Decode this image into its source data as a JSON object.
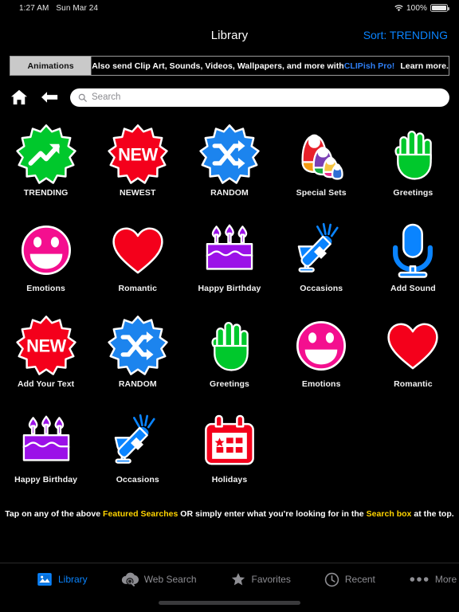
{
  "status_bar": {
    "time": "1:27 AM",
    "date": "Sun Mar 24",
    "battery_percent": "100%",
    "wifi_icon": "wifi-icon",
    "battery_icon": "battery-icon"
  },
  "navbar": {
    "title": "Library",
    "sort_label": "Sort: TRENDING",
    "accent_color": "#0a84ff"
  },
  "banner": {
    "tab_label": "Animations",
    "message_prefix": "Also send Clip Art, Sounds, Videos, Wallpapers, and more with ",
    "message_brand": "CLIPish Pro!",
    "learn_more": "Learn more.",
    "brand_color": "#2f7ff5"
  },
  "toolbar": {
    "home_icon": "home-icon",
    "back_icon": "back-arrow-icon",
    "search_icon": "search-icon",
    "search_value": "",
    "search_placeholder": "Search"
  },
  "grid": {
    "items": [
      {
        "label": "TRENDING",
        "icon": "trending-badge-icon",
        "color": "#00c82c"
      },
      {
        "label": "NEWEST",
        "icon": "new-badge-icon",
        "color": "#f4001b"
      },
      {
        "label": "RANDOM",
        "icon": "shuffle-badge-icon",
        "color": "#1c84ee"
      },
      {
        "label": "Special Sets",
        "icon": "nesting-dolls-icon",
        "color": "#e8202a"
      },
      {
        "label": "Greetings",
        "icon": "waving-hand-icon",
        "color": "#00c82c"
      },
      {
        "label": "Emotions",
        "icon": "smiley-face-icon",
        "color": "#f40f8f"
      },
      {
        "label": "Romantic",
        "icon": "heart-icon",
        "color": "#f4001b"
      },
      {
        "label": "Happy Birthday",
        "icon": "birthday-cake-icon",
        "color": "#9b11e8"
      },
      {
        "label": "Occasions",
        "icon": "champagne-toast-icon",
        "color": "#0a84ff"
      },
      {
        "label": "Add Sound",
        "icon": "microphone-icon",
        "color": "#0a84ff"
      },
      {
        "label": "Add Your Text",
        "icon": "new-badge-icon",
        "color": "#f4001b"
      },
      {
        "label": "RANDOM",
        "icon": "shuffle-badge-icon",
        "color": "#1c84ee"
      },
      {
        "label": "Greetings",
        "icon": "waving-hand-icon",
        "color": "#00c82c"
      },
      {
        "label": "Emotions",
        "icon": "smiley-face-icon",
        "color": "#f40f8f"
      },
      {
        "label": "Romantic",
        "icon": "heart-icon",
        "color": "#f4001b"
      },
      {
        "label": "Happy Birthday",
        "icon": "birthday-cake-icon",
        "color": "#9b11e8"
      },
      {
        "label": "Occasions",
        "icon": "champagne-toast-icon",
        "color": "#0a84ff"
      },
      {
        "label": "Holidays",
        "icon": "calendar-icon",
        "color": "#f4001b"
      }
    ],
    "badge_text_new": "NEW"
  },
  "hint": {
    "part1": "Tap on any of the above ",
    "highlight1": "Featured Searches",
    "part2": " OR simply enter what you're looking for in the ",
    "highlight2": "Search box",
    "part3": " at the top.",
    "highlight_color": "#ffd400"
  },
  "tabbar": {
    "items": [
      {
        "label": "Library",
        "icon": "photo-library-icon",
        "active": true
      },
      {
        "label": "Web Search",
        "icon": "cloud-search-icon",
        "active": false
      },
      {
        "label": "Favorites",
        "icon": "star-icon",
        "active": false
      },
      {
        "label": "Recent",
        "icon": "clock-icon",
        "active": false
      },
      {
        "label": "More",
        "icon": "ellipsis-icon",
        "active": false
      }
    ]
  }
}
